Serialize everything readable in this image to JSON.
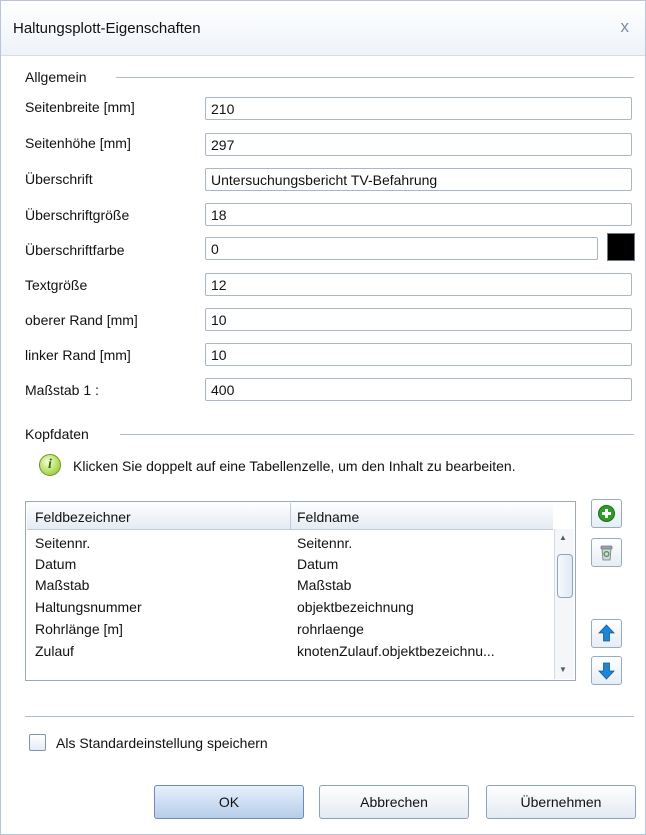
{
  "window": {
    "title": "Haltungsplott-Eigenschaften",
    "close_glyph": "x"
  },
  "general": {
    "heading": "Allgemein",
    "fields": [
      {
        "label": "Seitenbreite [mm]",
        "value": "210"
      },
      {
        "label": "Seitenhöhe [mm]",
        "value": "297"
      },
      {
        "label": "Überschrift",
        "value": "Untersuchungsbericht TV-Befahrung"
      },
      {
        "label": "Überschriftgröße",
        "value": "18"
      },
      {
        "label": "Überschriftfarbe",
        "value": "0"
      },
      {
        "label": "Textgröße",
        "value": "12"
      },
      {
        "label": "oberer Rand [mm]",
        "value": "10"
      },
      {
        "label": "linker Rand [mm]",
        "value": "10"
      },
      {
        "label": "Maßstab 1 :",
        "value": "400"
      }
    ],
    "heading_color": "#000000"
  },
  "header_data": {
    "heading": "Kopfdaten",
    "info_icon": "i",
    "info_text": "Klicken Sie doppelt auf eine Tabellenzelle, um den Inhalt zu bearbeiten.",
    "columns": [
      "Feldbezeichner",
      "Feldname"
    ],
    "rows": [
      [
        "Seitennr.",
        "Seitennr."
      ],
      [
        "Datum",
        "Datum"
      ],
      [
        "Maßstab",
        "Maßstab"
      ],
      [
        "Haltungsnummer",
        "objektbezeichnung"
      ],
      [
        "Rohrlänge [m]",
        "rohrlaenge"
      ],
      [
        "Zulauf",
        "knotenZulauf.objektbezeichnu..."
      ]
    ]
  },
  "icons": {
    "add": "plus-icon",
    "delete": "trash-icon",
    "up": "arrow-up-icon",
    "down": "arrow-down-icon"
  },
  "save_default": {
    "label": "Als Standardeinstellung speichern",
    "checked": false
  },
  "buttons": {
    "ok": "OK",
    "cancel": "Abbrechen",
    "apply": "Übernehmen"
  },
  "colors": {
    "accent_green": "#2f9b2a",
    "arrow_blue": "#1f86d6"
  }
}
